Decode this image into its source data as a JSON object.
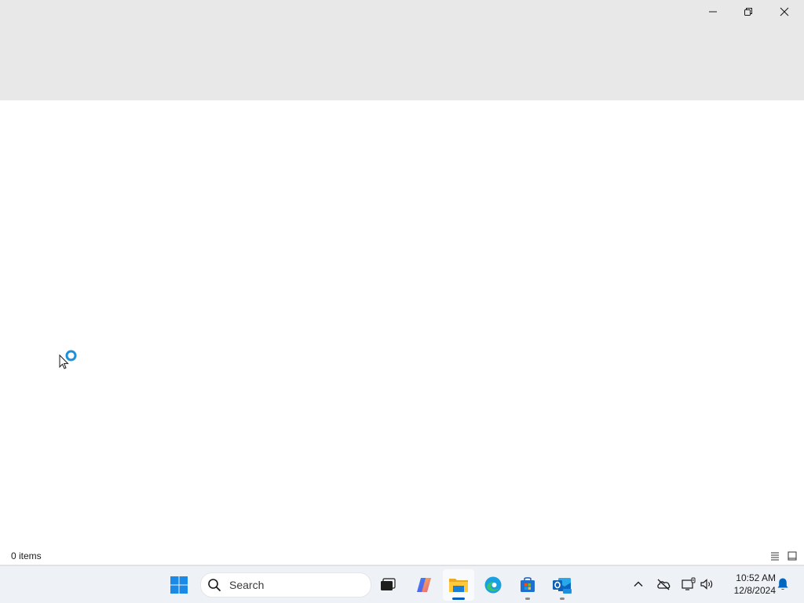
{
  "window": {
    "minimize_label": "Minimize",
    "restore_label": "Restore",
    "close_label": "Close"
  },
  "statusbar": {
    "item_count": "0 items"
  },
  "taskbar": {
    "search_placeholder": "Search",
    "apps": [
      {
        "name": "Start",
        "icon": "windows-logo-icon"
      },
      {
        "name": "Task View",
        "icon": "task-view-icon"
      },
      {
        "name": "Copilot",
        "icon": "copilot-icon"
      },
      {
        "name": "File Explorer",
        "icon": "folder-icon",
        "active": true
      },
      {
        "name": "Microsoft Edge",
        "icon": "edge-icon"
      },
      {
        "name": "Microsoft Store",
        "icon": "store-icon"
      },
      {
        "name": "Outlook (new)",
        "icon": "outlook-icon"
      }
    ],
    "tray": {
      "time": "10:52 AM",
      "date": "12/8/2024"
    }
  },
  "colors": {
    "accent": "#005fb8",
    "header_bg": "#e8e8e8",
    "taskbar_bg": "#eef1f6"
  }
}
